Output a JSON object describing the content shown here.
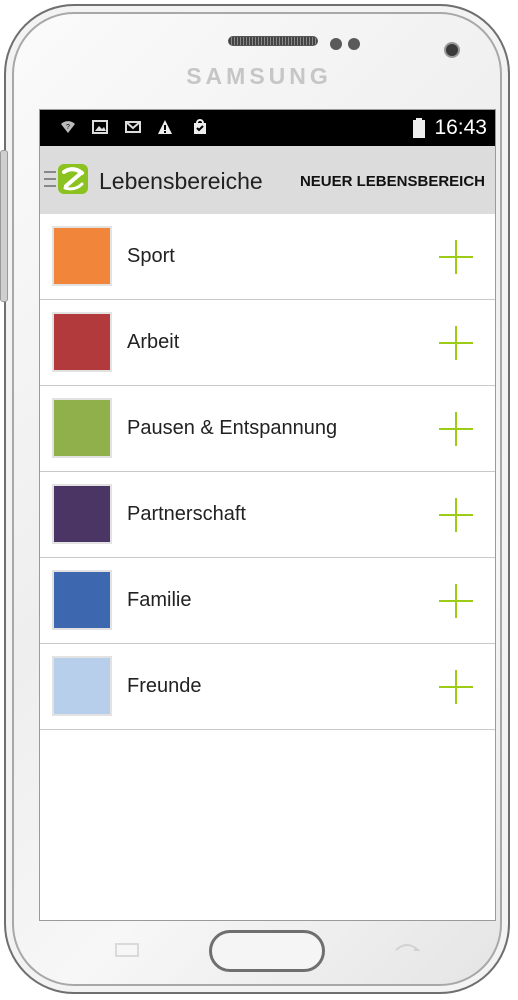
{
  "device": {
    "brand": "SAMSUNG"
  },
  "status_bar": {
    "time": "16:43",
    "icons": [
      "wifi-icon",
      "image-icon",
      "mail-icon",
      "warning-icon",
      "shopping-bag-icon",
      "battery-icon"
    ]
  },
  "action_bar": {
    "title": "Lebensbereiche",
    "new_button_label": "NEUER LEBENSBEREICH"
  },
  "areas": [
    {
      "label": "Sport",
      "color": "#f18539"
    },
    {
      "label": "Arbeit",
      "color": "#b2393c"
    },
    {
      "label": "Pausen & Entspannung",
      "color": "#8fb04a"
    },
    {
      "label": "Partnerschaft",
      "color": "#4a3564"
    },
    {
      "label": "Familie",
      "color": "#3d67ae"
    },
    {
      "label": "Freunde",
      "color": "#b8cfeb"
    }
  ],
  "accent_color": "#9ccc18"
}
